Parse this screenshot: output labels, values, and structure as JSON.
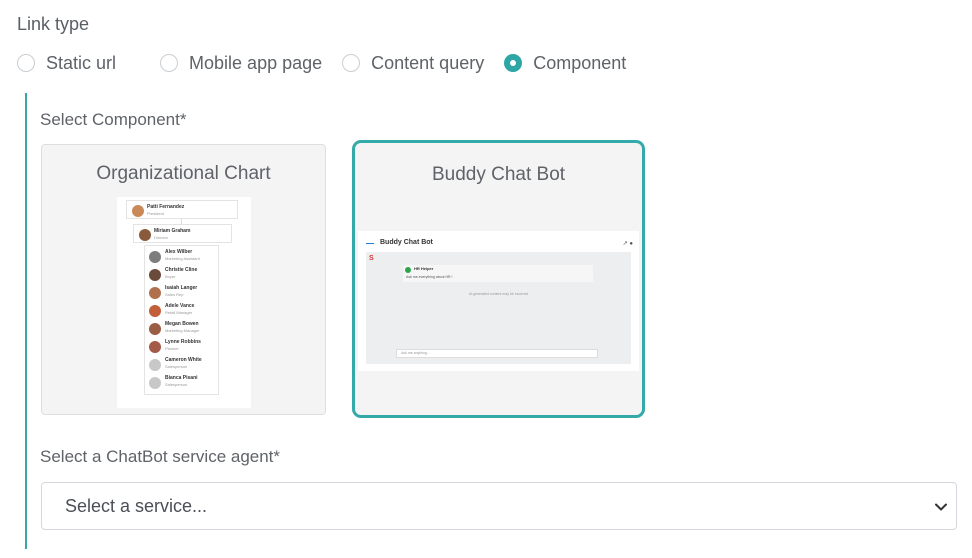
{
  "link_type": {
    "label": "Link type",
    "options": [
      {
        "label": "Static url",
        "selected": false
      },
      {
        "label": "Mobile app page",
        "selected": false
      },
      {
        "label": "Content query",
        "selected": false
      },
      {
        "label": "Component",
        "selected": true
      }
    ]
  },
  "select_component": {
    "label": "Select Component*",
    "cards": [
      {
        "title": "Organizational Chart",
        "selected": false,
        "preview": {
          "top_nodes": [
            {
              "name": "Patti Fernandez",
              "role": "President"
            },
            {
              "name": "Miriam Graham",
              "role": "Director"
            }
          ],
          "members": [
            {
              "name": "Alex Wilber",
              "role": "Marketing Assistant"
            },
            {
              "name": "Christie Cline",
              "role": "Buyer"
            },
            {
              "name": "Isaiah Langer",
              "role": "Sales Rep"
            },
            {
              "name": "Adele Vance",
              "role": "Retail Manager"
            },
            {
              "name": "Megan Bowen",
              "role": "Marketing Manager"
            },
            {
              "name": "Lynne Robbins",
              "role": "Planner"
            },
            {
              "name": "Cameron White",
              "role": "Salesperson"
            },
            {
              "name": "Bianca Pisani",
              "role": "Salesperson"
            }
          ]
        }
      },
      {
        "title": "Buddy Chat Bot",
        "selected": true,
        "preview": {
          "header": "Buddy Chat Bot",
          "agent_name": "HR Helper",
          "message": "Ask me everything about HR !",
          "note": "AI-generated content may be incorrect",
          "input_placeholder": "Ask me anything..."
        }
      }
    ]
  },
  "chatbot_agent": {
    "label": "Select a ChatBot service agent*",
    "select_value": "Select a service..."
  },
  "colors": {
    "accent": "#33a9a9",
    "text": "#5f6368",
    "card_bg": "#f4f4f4"
  }
}
